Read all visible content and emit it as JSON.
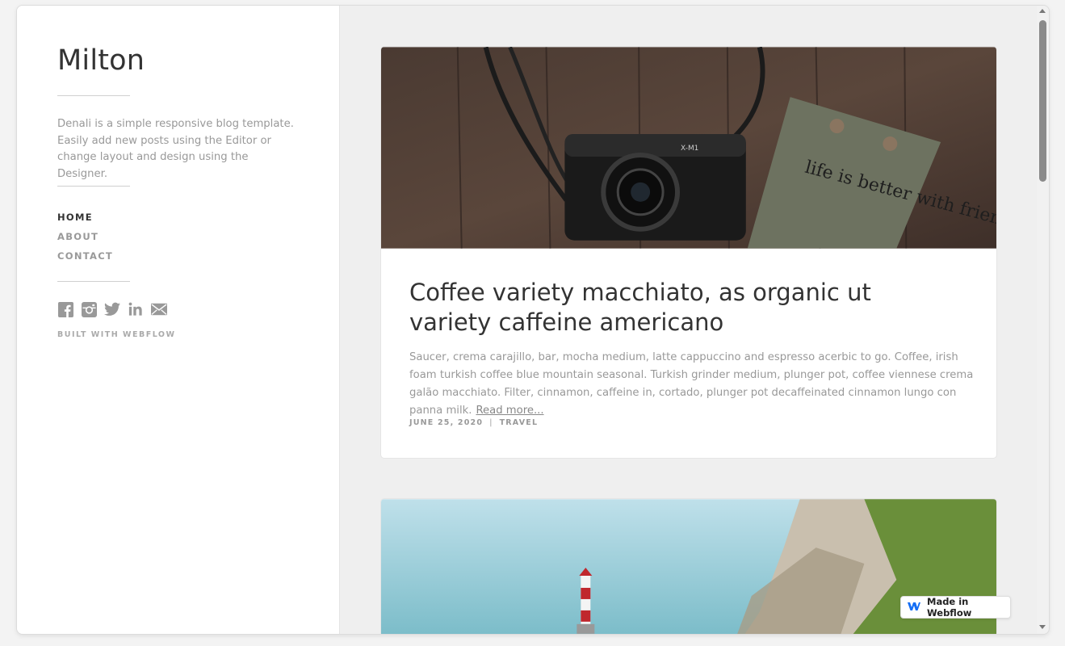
{
  "sidebar": {
    "brand": "Milton",
    "description": "Denali is a simple responsive blog template. Easily add new posts using the Editor or change layout and design using the Designer.",
    "nav": [
      {
        "label": "HOME",
        "active": true
      },
      {
        "label": "ABOUT",
        "active": false
      },
      {
        "label": "CONTACT",
        "active": false
      }
    ],
    "social_icons": [
      "facebook-icon",
      "instagram-icon",
      "twitter-icon",
      "linkedin-icon",
      "mail-icon"
    ],
    "built_with": "BUILT WITH WEBFLOW"
  },
  "posts": [
    {
      "title": "Coffee variety macchiato, as organic ut variety caffeine americano",
      "excerpt": "Saucer, crema carajillo, bar, mocha medium, latte cappuccino and espresso acerbic to go. Coffee, irish foam turkish coffee blue mountain seasonal. Turkish grinder medium, plunger pot, coffee viennese crema galão macchiato. Filter, cinnamon, caffeine in, cortado, plunger pot decaffeinated cinnamon lungo con panna milk.",
      "read_more": "Read more...",
      "date": "JUNE 25, 2020",
      "separator": "|",
      "category": "TRAVEL",
      "notebook_text": "life is better with friends",
      "camera_text": "X-M1"
    }
  ],
  "badge": {
    "label": "Made in Webflow"
  },
  "colors": {
    "text_dark": "#333333",
    "text_muted": "#999999",
    "bg": "#efefef"
  }
}
